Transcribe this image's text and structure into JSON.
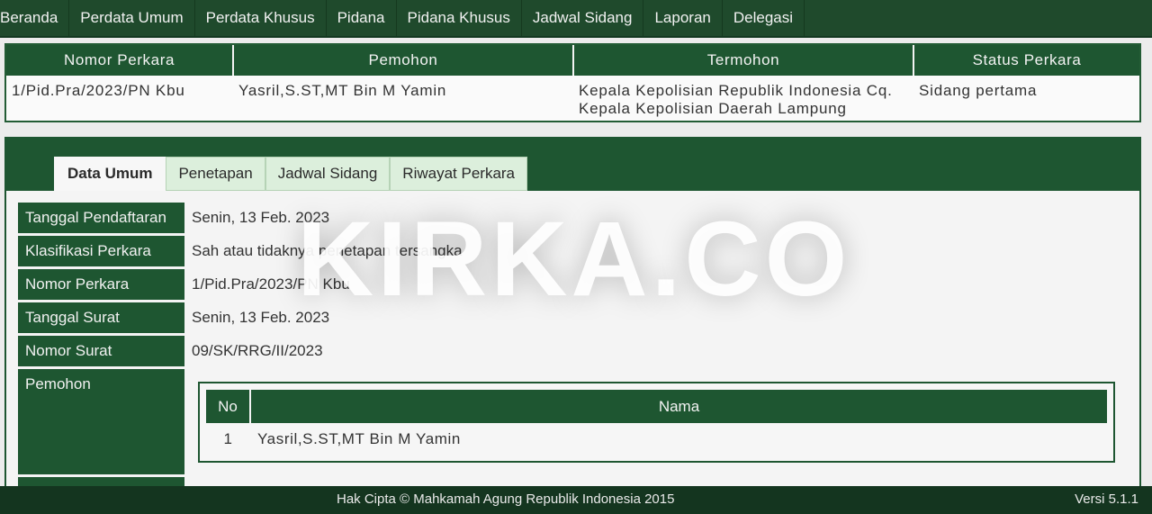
{
  "nav": {
    "items": [
      "Beranda",
      "Perdata Umum",
      "Perdata Khusus",
      "Pidana",
      "Pidana Khusus",
      "Jadwal Sidang",
      "Laporan",
      "Delegasi"
    ]
  },
  "summary": {
    "headers": [
      "Nomor Perkara",
      "Pemohon",
      "Termohon",
      "Status Perkara"
    ],
    "row": {
      "nomor": "1/Pid.Pra/2023/PN Kbu",
      "pemohon": "Yasril,S.ST,MT Bin M Yamin",
      "termohon_line1": "Kepala Kepolisian Republik Indonesia Cq.",
      "termohon_line2": "Kepala Kepolisian Daerah Lampung",
      "status": "Sidang pertama"
    }
  },
  "tabs": [
    "Data Umum",
    "Penetapan",
    "Jadwal Sidang",
    "Riwayat Perkara"
  ],
  "fields": [
    {
      "label": "Tanggal Pendaftaran",
      "value": "Senin, 13 Feb. 2023"
    },
    {
      "label": "Klasifikasi Perkara",
      "value": "Sah atau tidaknya penetapan tersangka"
    },
    {
      "label": "Nomor Perkara",
      "value": "1/Pid.Pra/2023/PN Kbu"
    },
    {
      "label": "Tanggal Surat",
      "value": "Senin, 13 Feb. 2023"
    },
    {
      "label": "Nomor Surat",
      "value": "09/SK/RRG/II/2023"
    },
    {
      "label": "Pemohon",
      "value": ""
    }
  ],
  "pemohon_table": {
    "headers": [
      "No",
      "Nama"
    ],
    "rows": [
      {
        "no": "1",
        "nama": "Yasril,S.ST,MT Bin M Yamin"
      }
    ]
  },
  "watermark": "KIRKA.CO",
  "footer": {
    "copyright": "Hak Cipta © Mahkamah Agung Republik Indonesia 2015",
    "version": "Versi 5.1.1"
  },
  "colors": {
    "primary_green": "#1e5631",
    "tab_inactive": "#dcefdc"
  }
}
